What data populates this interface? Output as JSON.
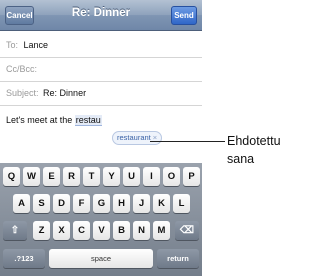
{
  "navbar": {
    "title": "Re: Dinner",
    "cancel_label": "Cancel",
    "send_label": "Send"
  },
  "fields": {
    "to_label": "To:",
    "to_value": "Lance",
    "cc_label": "Cc/Bcc:",
    "subject_label": "Subject:",
    "subject_value": "Re: Dinner"
  },
  "body": {
    "text_prefix": "Let's meet at the",
    "typed_word": "restau"
  },
  "suggestion": {
    "word": "restaurant",
    "dismiss": "×"
  },
  "callout": {
    "line1": "Ehdotettu",
    "line2": "sana"
  },
  "keyboard": {
    "row1": [
      "Q",
      "W",
      "E",
      "R",
      "T",
      "Y",
      "U",
      "I",
      "O",
      "P"
    ],
    "row2": [
      "A",
      "S",
      "D",
      "F",
      "G",
      "H",
      "J",
      "K",
      "L"
    ],
    "row3": [
      "Z",
      "X",
      "C",
      "V",
      "B",
      "N",
      "M"
    ],
    "shift": "⇧",
    "backspace": "⌫",
    "numbers_label": ".?123",
    "space_label": "space",
    "return_label": "return"
  }
}
